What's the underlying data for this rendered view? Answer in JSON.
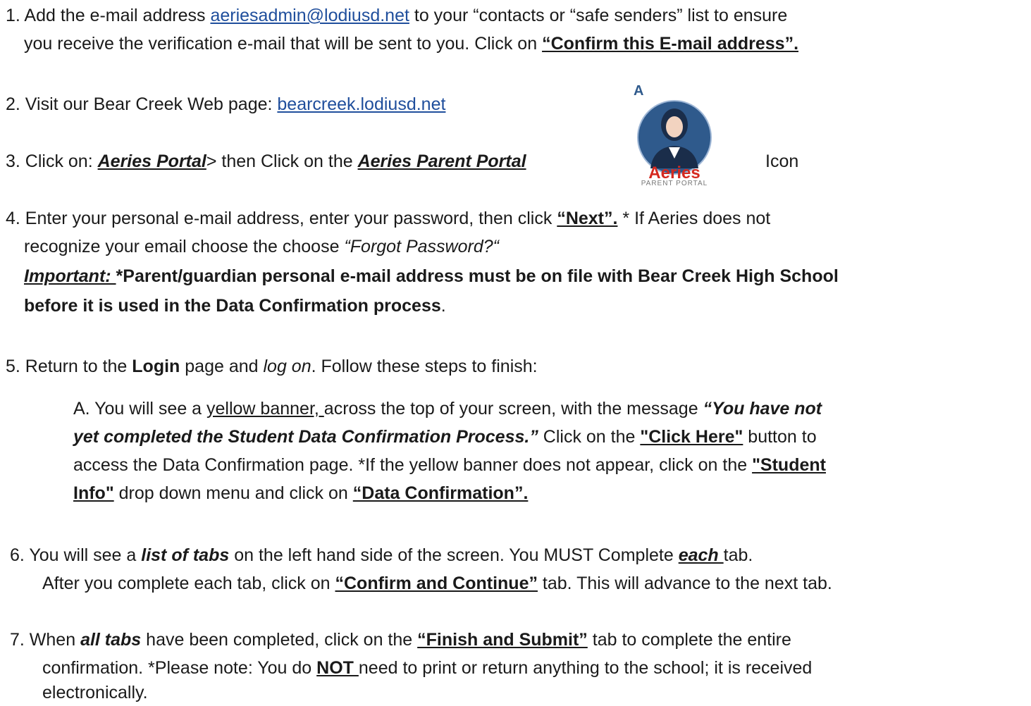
{
  "step1": {
    "prefix": "1.  Add the e-mail address ",
    "email": "aeriesadmin@lodiusd.net",
    "suffix": " to your “contacts or “safe senders” list to ensure",
    "line2": "you  receive the verification e-mail that will be sent to you. Click on ",
    "bold_link": "“Confirm this E-mail address”."
  },
  "step2": {
    "prefix": "2.  Visit our Bear Creek Web page: ",
    "link": "bearcreek.lodiusd.net"
  },
  "step3": {
    "prefix": "3.  Click on: ",
    "portal": "Aeries Portal",
    "middle": "> then Click on the ",
    "parent_portal": "Aeries Parent Portal",
    "icon_word": "Icon"
  },
  "logo": {
    "mark": "A",
    "word": "Aeries",
    "sub": "PARENT PORTAL",
    "colors": {
      "blue": "#2f5a8c",
      "red": "#d5291f",
      "skin": "#f2d3c0"
    }
  },
  "step4": {
    "line1a": "4.  Enter your personal e-mail address, enter your password, then click ",
    "next": "“Next”.",
    "line1b": "  * If Aeries does not",
    "line2a": "recognize your email choose the choose ",
    "forgot": "“Forgot Password?“",
    "important": "Important: ",
    "imp_text1": "*Parent/guardian personal e-mail address must be on file with Bear Creek High School",
    "imp_text2": "before it is used in the Data Confirmation process",
    "imp_end": "."
  },
  "step5": {
    "a": "5.  Return to the ",
    "login": "Login",
    "b": " page and ",
    "logon": "log on",
    "c": ". Follow these steps to finish:"
  },
  "stepA": {
    "l1a": "A. You will see a ",
    "banner": "yellow banner, ",
    "l1b": "across the top of your screen, with the message ",
    "l1c": "“You have not",
    "l2a": "yet completed the Student Data Confirmation Process.”",
    "l2b": "  Click on the ",
    "click_here": "\"Click Here\"",
    "l2c": " button to",
    "l3a": "access the Data Confirmation page. *If the yellow banner does not appear, click on the ",
    "student": "\"Student",
    "l4a": "Info\"",
    "l4b": " drop down menu and click on ",
    "data_conf": "“Data Confirmation”."
  },
  "step6": {
    "l1a": "6.  You will see a ",
    "list": "list of tabs",
    "l1b": " on the left hand side of the screen. You MUST Complete ",
    "each": "each ",
    "l1c": "tab.",
    "l2a": "After you complete each tab, click on ",
    "confirm": "“Confirm and Continue”",
    "l2b": " tab. This will advance to the next tab."
  },
  "step7": {
    "l1a": "7.  When ",
    "all": "all tabs",
    "l1b": " have been completed, click on the ",
    "finish": "“Finish and Submit”",
    "l1c": " tab to complete the entire",
    "l2a": "confirmation. *Please note: You do ",
    "not": "NOT ",
    "l2b": "need to  print or return anything to the school; it is received",
    "l3": "electronically."
  }
}
